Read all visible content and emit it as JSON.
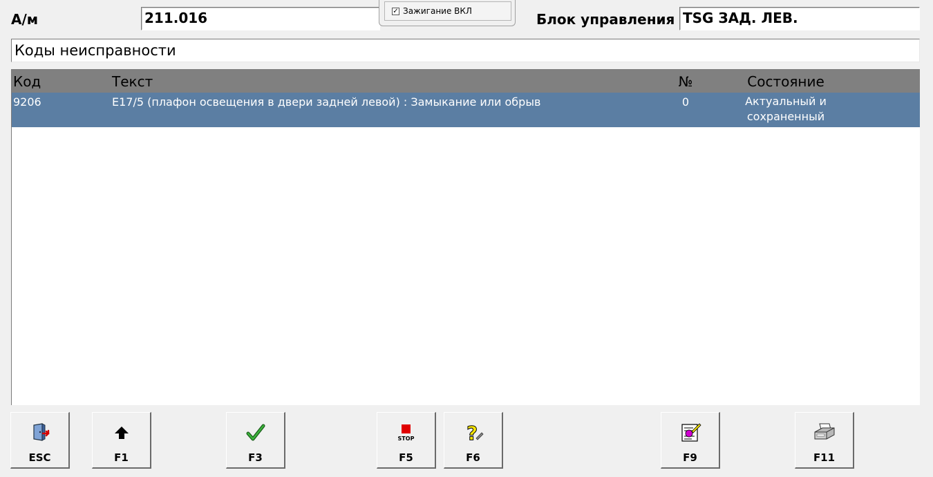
{
  "header": {
    "vehicle_label": "А/м",
    "vehicle_value": "211.016",
    "ignition_checkbox": {
      "label": "Зажигание ВКЛ",
      "checked": true
    },
    "control_unit_label": "Блок управления",
    "control_unit_value": "TSG ЗАД. ЛЕВ."
  },
  "section_title": "Коды неисправности",
  "table": {
    "columns": {
      "code": "Код",
      "text": "Текст",
      "number": "№",
      "state": "Состояние"
    },
    "rows": [
      {
        "code": "9206",
        "text": "E17/5 (плафон освещения в двери задней левой) : Замыкание или обрыв",
        "number": "0",
        "state": "Актуальный и сохраненный",
        "selected": true
      }
    ]
  },
  "colors": {
    "selected_row": "#5b7ea3",
    "header_bg": "#808080",
    "window_bg": "#f0f0f0"
  },
  "buttons": [
    {
      "key": "ESC",
      "icon": "exit-door-icon"
    },
    {
      "key": "F1",
      "icon": "arrow-up-icon"
    },
    {
      "key": "F3",
      "icon": "checkmark-icon"
    },
    {
      "key": "F5",
      "icon": "stop-icon",
      "icon_text": "STOP"
    },
    {
      "key": "F6",
      "icon": "help-question-icon"
    },
    {
      "key": "F9",
      "icon": "edit-document-icon"
    },
    {
      "key": "F11",
      "icon": "printer-icon"
    }
  ]
}
